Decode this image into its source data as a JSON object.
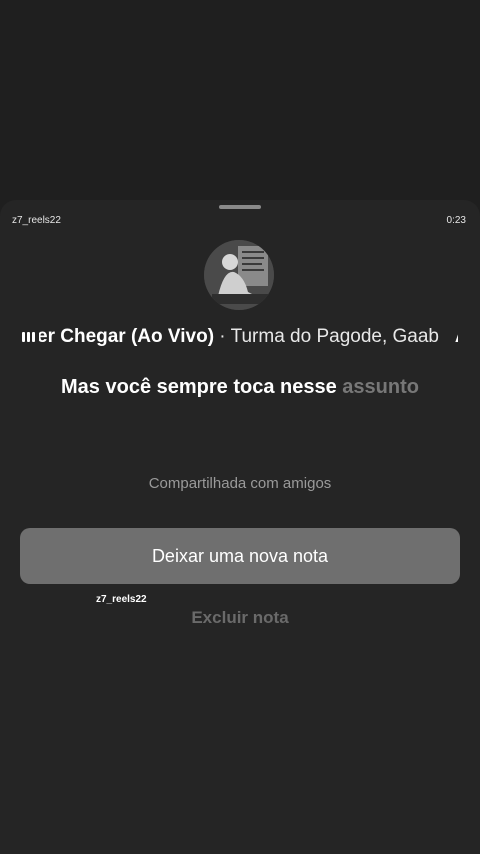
{
  "watermark": "z7_reels22",
  "timestamp": "0:23",
  "music": {
    "track_text": "er Chegar (Ao Vivo)",
    "separator": " · ",
    "artist_text": "Turma do Pagode, Gaab",
    "repeat_text": "Ao"
  },
  "lyric": {
    "main": "Mas você sempre toca nesse",
    "dim": "assunto"
  },
  "shared_label": "Compartilhada com amigos",
  "new_note_button": "Deixar uma nova nota",
  "delete_note_button": "Excluir nota",
  "colors": {
    "background": "#1f1f1f",
    "sheet": "#252525",
    "primary_button": "#6f6f6f"
  }
}
